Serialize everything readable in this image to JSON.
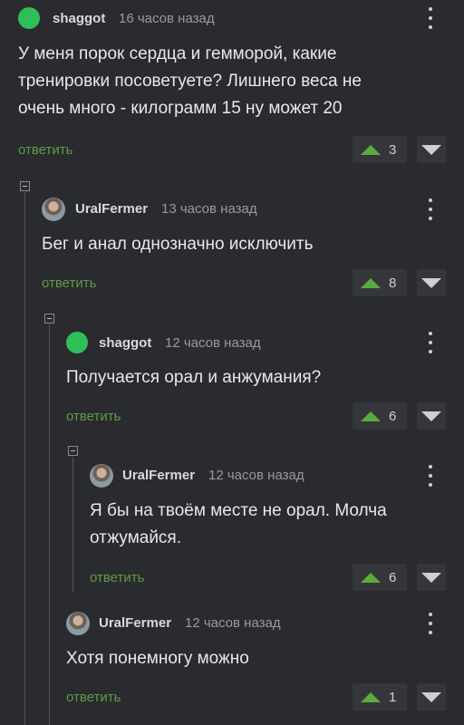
{
  "comments": [
    {
      "username": "shaggot",
      "time": "16 часов назад",
      "text_lines": [
        "У меня порок сердца и гемморой, какие",
        "тренировки посоветуете? Лишнего веса не",
        "очень много - килограмм 15 ну может 20"
      ],
      "reply": "ответить",
      "votes": "3"
    },
    {
      "username": "UralFermer",
      "time": "13 часов назад",
      "text_lines": [
        "Бег и анал однозначно исключить"
      ],
      "reply": "ответить",
      "votes": "8"
    },
    {
      "username": "shaggot",
      "time": "12 часов назад",
      "text_lines": [
        "Получается орал и анжумания?"
      ],
      "reply": "ответить",
      "votes": "6"
    },
    {
      "username": "UralFermer",
      "time": "12 часов назад",
      "text_lines": [
        "Я бы на твоём месте не орал. Молча",
        "отжумайся."
      ],
      "reply": "ответить",
      "votes": "6"
    },
    {
      "username": "UralFermer",
      "time": "12 часов назад",
      "text_lines": [
        "Хотя понемногу можно"
      ],
      "reply": "ответить",
      "votes": "1"
    }
  ],
  "colors": {
    "background": "#2a2b2e",
    "reply": "#5e9a48",
    "upvote": "#5caa40",
    "avatar_green": "#2fbf5a"
  },
  "icons": {
    "menu": "more-vertical-icon",
    "collapse": "collapse-minus-icon",
    "upvote": "triangle-up-icon",
    "downvote": "triangle-down-icon"
  }
}
